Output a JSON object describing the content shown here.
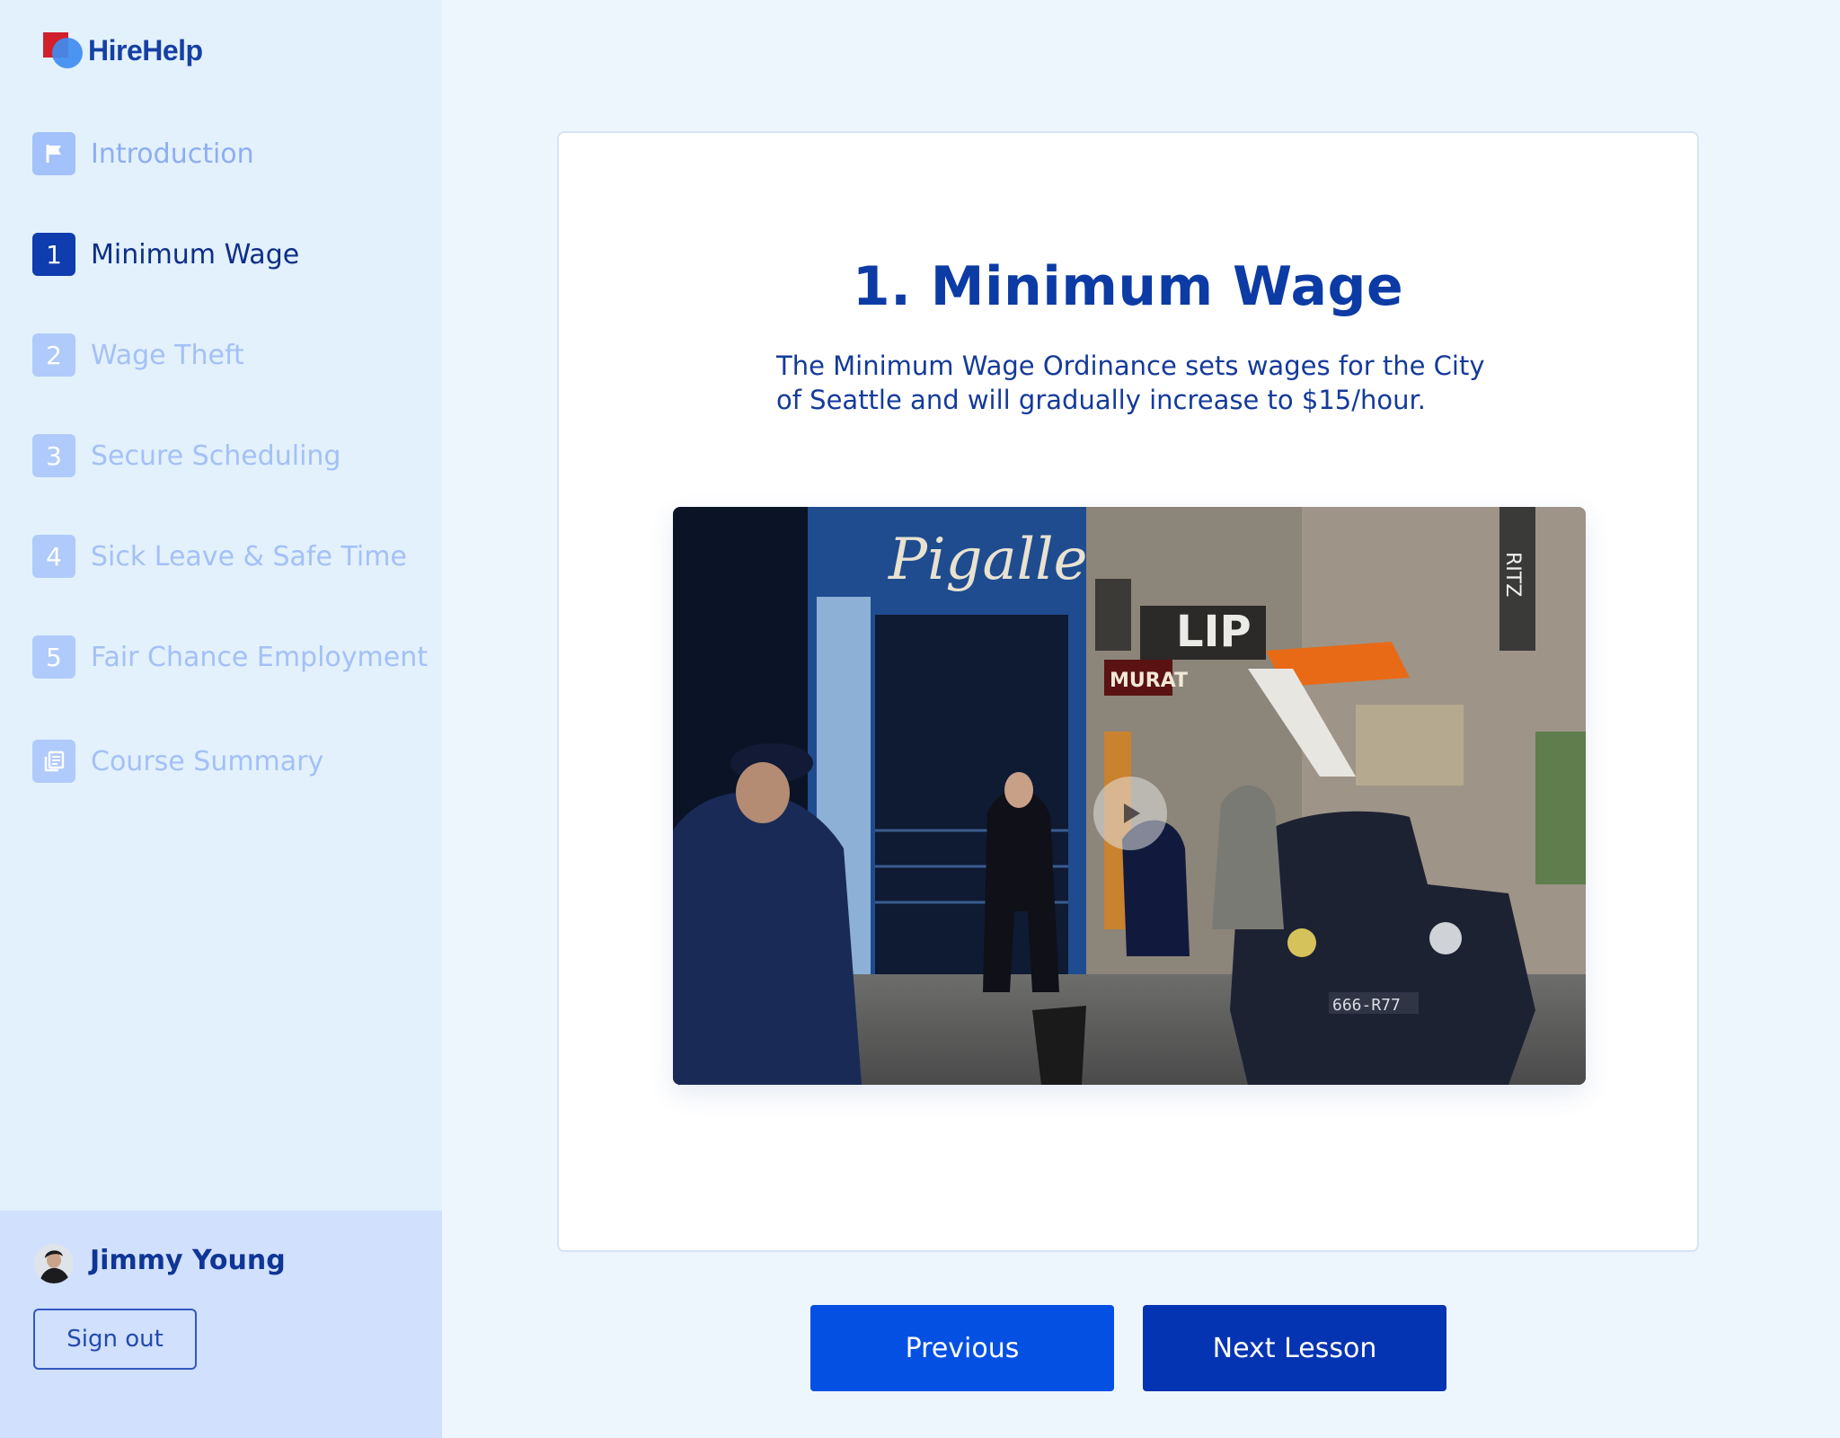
{
  "app": {
    "name": "HireHelp"
  },
  "sidebar": {
    "items": [
      {
        "badge": "",
        "icon": "flag-icon",
        "label": "Introduction",
        "state": "normal"
      },
      {
        "badge": "1",
        "label": "Minimum Wage",
        "state": "active"
      },
      {
        "badge": "2",
        "label": "Wage Theft",
        "state": "dim"
      },
      {
        "badge": "3",
        "label": "Secure Scheduling",
        "state": "dim"
      },
      {
        "badge": "4",
        "label": "Sick Leave & Safe Time",
        "state": "dim"
      },
      {
        "badge": "5",
        "label": "Fair Chance Employment",
        "state": "dim"
      },
      {
        "badge": "",
        "icon": "document-icon",
        "label": "Course Summary",
        "state": "dim"
      }
    ]
  },
  "user": {
    "name": "Jimmy Young",
    "sign_out_label": "Sign out"
  },
  "lesson": {
    "title": "1. Minimum Wage",
    "description": "The Minimum Wage Ordinance sets wages for the City of Seattle and will gradually increase to $15/hour.",
    "video": {
      "icon": "play-icon"
    }
  },
  "footer": {
    "previous_label": "Previous",
    "next_label": "Next Lesson"
  },
  "colors": {
    "primary": "#0d3ba5",
    "button_previous": "#0450e3",
    "button_next": "#0534b3",
    "sidebar_bg": "#e2f1fc"
  }
}
